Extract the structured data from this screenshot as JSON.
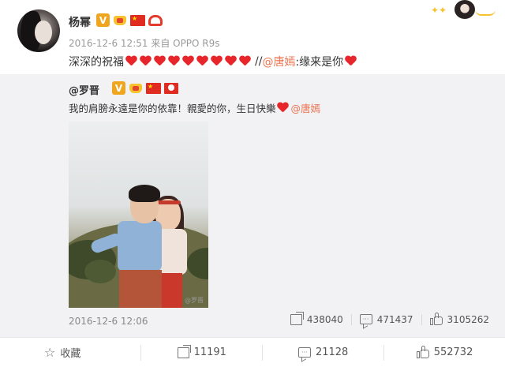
{
  "post": {
    "author": "杨幂",
    "meta": "2016-12-6 12:51 来自 OPPO R9s",
    "text_prefix": "深深的祝福",
    "heart_count": 9,
    "repost_sep": "//",
    "mention": "@唐嫣",
    "quote_text": ":缘来是你"
  },
  "repost": {
    "author": "@罗晋",
    "text": "我的肩膀永遠是你的依靠！親愛的你，生日快樂",
    "mention": "@唐嫣",
    "photo_watermark": "@罗晋",
    "timestamp": "2016-12-6 12:06",
    "shares": "438040",
    "comments": "471437",
    "likes": "3105262"
  },
  "actions": {
    "favorite_label": "收藏",
    "share_count": "11191",
    "comment_count": "21128",
    "like_count": "552732"
  },
  "colors": {
    "link": "#eb7350",
    "heart": "#e6262a",
    "repost_bg": "#f2f2f5",
    "vip": "#f0a51e"
  },
  "icons": {
    "share": "share-icon",
    "comment": "comment-icon",
    "like": "like-icon",
    "favorite": "star-icon"
  }
}
